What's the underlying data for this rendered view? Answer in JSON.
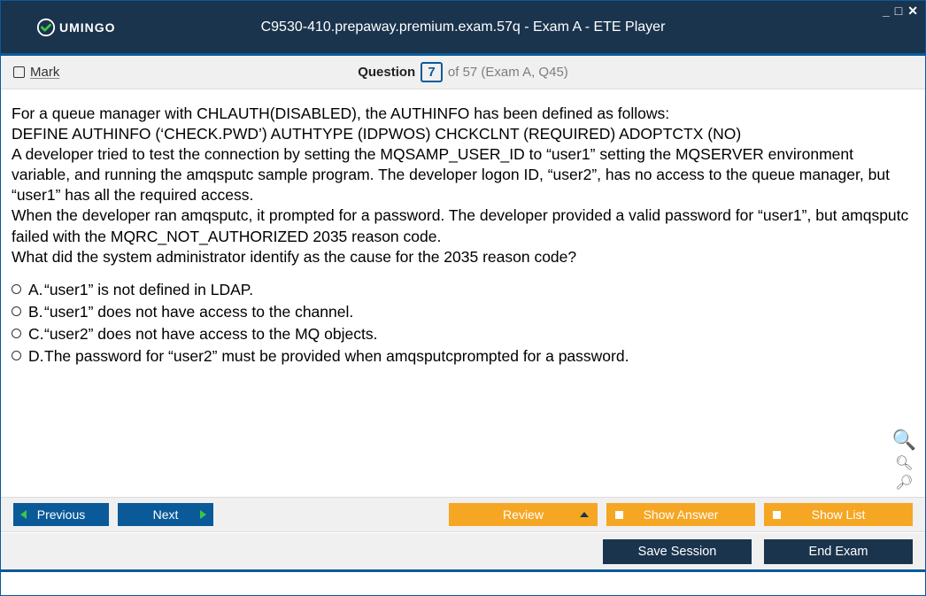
{
  "window": {
    "title": "C9530-410.prepaway.premium.exam.57q - Exam A - ETE Player",
    "logo_text": "UMINGO"
  },
  "header": {
    "mark_label": "Mark",
    "question_word": "Question",
    "question_number": "7",
    "rest": "of 57 (Exam A, Q45)"
  },
  "stem": [
    "For a queue manager with CHLAUTH(DISABLED), the AUTHINFO has been defined as follows:",
    "DEFINE AUTHINFO (‘CHECK.PWD’) AUTHTYPE (IDPWOS) CHCKCLNT (REQUIRED) ADOPTCTX (NO)",
    "A developer tried to test the connection by setting the MQSAMP_USER_ID to “user1” setting the MQSERVER environment variable, and running the amqsputc sample program. The developer logon ID, “user2”, has no access to the queue manager, but “user1” has all the required access.",
    "When the developer ran amqsputc, it prompted for a password. The developer provided a valid password for “user1”, but amqsputc  failed with the MQRC_NOT_AUTHORIZED 2035 reason code.",
    "What did the system administrator identify as the cause for the 2035 reason code?"
  ],
  "options": [
    {
      "letter": "A.",
      "text": "“user1” is not defined in LDAP."
    },
    {
      "letter": "B.",
      "text": "“user1” does not have access to the channel."
    },
    {
      "letter": "C.",
      "text": "“user2” does not have access to the MQ objects."
    },
    {
      "letter": "D.",
      "text": "The password for “user2” must be provided when amqsputcprompted for a password."
    }
  ],
  "footer": {
    "previous": "Previous",
    "next": "Next",
    "review": "Review",
    "show_answer": "Show Answer",
    "show_list": "Show List",
    "save_session": "Save Session",
    "end_exam": "End Exam"
  }
}
